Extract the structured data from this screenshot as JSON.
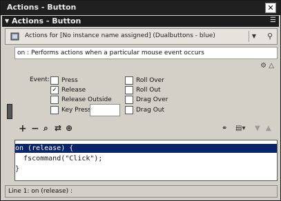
{
  "window": {
    "title": "Actions - Button",
    "close_icon": "close-icon"
  },
  "panel": {
    "label": "Actions for [No instance name assigned] (Dualbuttons - blue)",
    "icon": "button-symbol-icon"
  },
  "help": {
    "text": "on : Performs actions when a particular mouse event occurs"
  },
  "events": {
    "label": "Event:",
    "left_options": [
      {
        "label": "Press",
        "checked": false
      },
      {
        "label": "Release",
        "checked": true
      },
      {
        "label": "Release Outside",
        "checked": false
      },
      {
        "label": "Key Press:",
        "checked": false
      }
    ],
    "right_options": [
      {
        "label": "Roll Over",
        "checked": false
      },
      {
        "label": "Roll Out",
        "checked": false
      },
      {
        "label": "Drag Over",
        "checked": false
      },
      {
        "label": "Drag Out",
        "checked": false
      }
    ],
    "key_press_value": ""
  },
  "toolbar": {
    "add": "+",
    "remove": "−",
    "left_icons": [
      "find-icon",
      "replace-icon",
      "target-icon"
    ],
    "right_icons": [
      "debug-options-icon",
      "view-options-icon",
      "move-down-icon",
      "move-up-icon"
    ]
  },
  "code": {
    "lines": [
      "on (release) {",
      "  fscommand(\"Click\");",
      "}"
    ],
    "selected_line": 0
  },
  "status": {
    "text": "Line 1: on (release) :"
  }
}
